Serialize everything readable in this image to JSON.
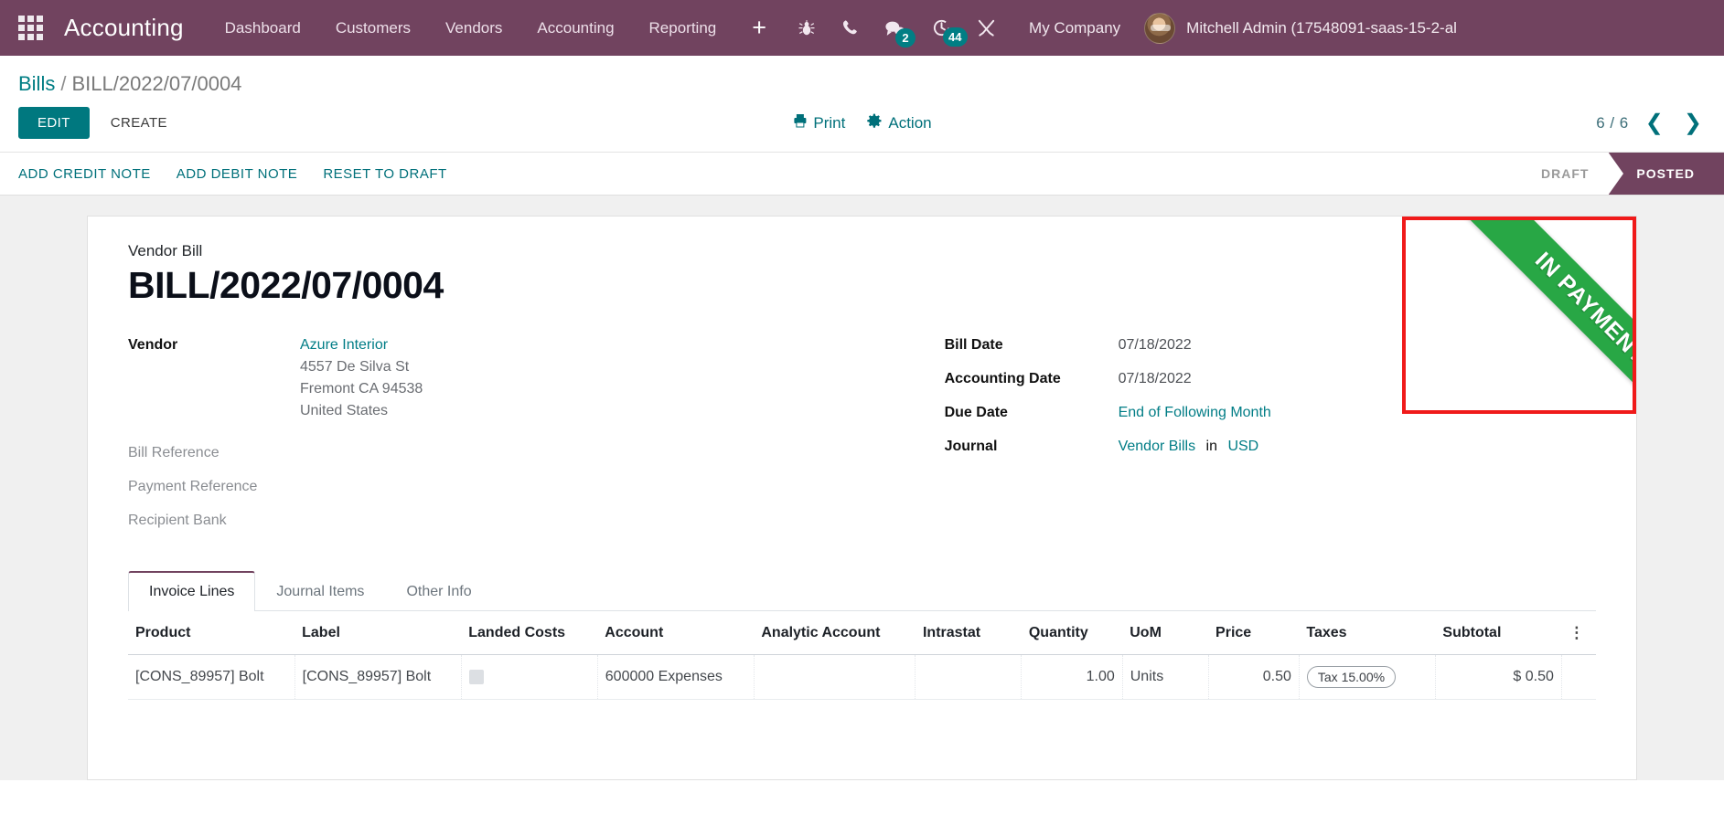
{
  "navbar": {
    "apps_icon": "apps-grid-icon",
    "brand": "Accounting",
    "menus": [
      "Dashboard",
      "Customers",
      "Vendors",
      "Accounting",
      "Reporting"
    ],
    "plus_label": "+",
    "icons": [
      {
        "name": "bug-icon",
        "badge": null
      },
      {
        "name": "phone-icon",
        "badge": null
      },
      {
        "name": "messages-icon",
        "badge": "2"
      },
      {
        "name": "activities-clock-icon",
        "badge": "44"
      },
      {
        "name": "tools-icon",
        "badge": null
      }
    ],
    "company": "My Company",
    "username": "Mitchell Admin (17548091-saas-15-2-al"
  },
  "breadcrumb": {
    "root": "Bills",
    "separator": "/",
    "current": "BILL/2022/07/0004"
  },
  "control_panel": {
    "edit_label": "EDIT",
    "create_label": "CREATE",
    "print_label": "Print",
    "action_label": "Action",
    "pager": "6 / 6",
    "prev_icon": "chevron-left-icon",
    "next_icon": "chevron-right-icon"
  },
  "statusbar": {
    "actions": [
      "ADD CREDIT NOTE",
      "ADD DEBIT NOTE",
      "RESET TO DRAFT"
    ],
    "statuses": [
      {
        "label": "DRAFT",
        "active": false
      },
      {
        "label": "POSTED",
        "active": true
      }
    ]
  },
  "ribbon": {
    "text": "IN PAYMENT",
    "color": "#28a745",
    "highlight_border": "#f01a1a"
  },
  "form": {
    "doc_type": "Vendor Bill",
    "title": "BILL/2022/07/0004",
    "vendor_label": "Vendor",
    "vendor_name": "Azure Interior",
    "vendor_address": [
      "4557 De Silva St",
      "Fremont CA 94538",
      "United States"
    ],
    "bill_reference_label": "Bill Reference",
    "payment_reference_label": "Payment Reference",
    "recipient_bank_label": "Recipient Bank",
    "bill_date_label": "Bill Date",
    "bill_date": "07/18/2022",
    "accounting_date_label": "Accounting Date",
    "accounting_date": "07/18/2022",
    "due_date_label": "Due Date",
    "due_date": "End of Following Month",
    "journal_label": "Journal",
    "journal": "Vendor Bills",
    "journal_in": "in",
    "currency": "USD"
  },
  "notebook": {
    "tabs": [
      {
        "label": "Invoice Lines",
        "active": true
      },
      {
        "label": "Journal Items",
        "active": false
      },
      {
        "label": "Other Info",
        "active": false
      }
    ]
  },
  "lines_table": {
    "columns": [
      "Product",
      "Label",
      "Landed Costs",
      "Account",
      "Analytic Account",
      "Intrastat",
      "Quantity",
      "UoM",
      "Price",
      "Taxes",
      "Subtotal"
    ],
    "optional_columns_icon": "vertical-dots-icon",
    "rows": [
      {
        "product": "[CONS_89957] Bolt",
        "label": "[CONS_89957] Bolt",
        "landed_costs": "",
        "account": "600000 Expenses",
        "analytic_account": "",
        "intrastat": "",
        "quantity": "1.00",
        "uom": "Units",
        "price": "0.50",
        "taxes": "Tax 15.00%",
        "subtotal": "$ 0.50"
      }
    ]
  },
  "colors": {
    "navbar": "#71435f",
    "accent": "#017e84",
    "badge": "#017e84"
  }
}
